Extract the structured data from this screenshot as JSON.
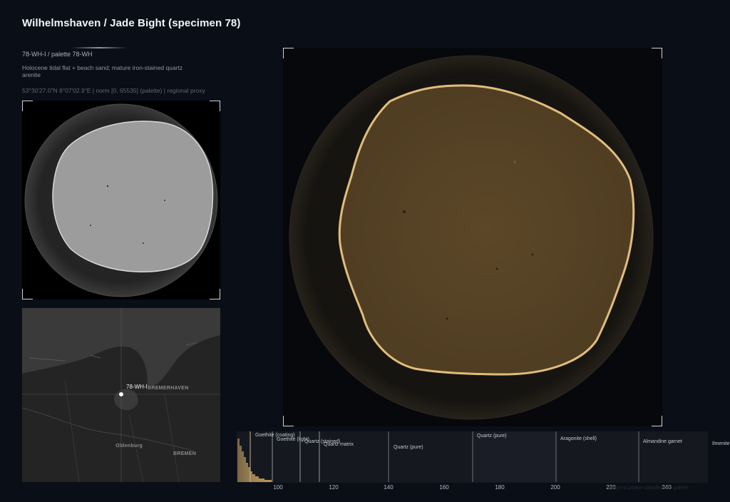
{
  "header": {
    "title": "Wilhelmshaven / Jade Bight (specimen 78)",
    "ident": "78-WH-I  /  palette 78-WH",
    "description": "Holocene tidal flat + beach sand; mature iron-stained quartz arenite",
    "coords": "53°30'27.0\"N 8°07'02.9\"E  |  norm [0, 65535] (palette)  |  regional proxy"
  },
  "map": {
    "pin_label": "78-WH-I",
    "cities": [
      "BREMERHAVEN",
      "Oldenburg",
      "BREMEN"
    ]
  },
  "histogram": {
    "phases": [
      {
        "label": "Goethite (coating)"
      },
      {
        "label": "Goethite (light)"
      },
      {
        "label": "Quartz (stained)"
      },
      {
        "label": "Quartz matrix"
      },
      {
        "label": "Quartz (pure)"
      },
      {
        "label": "Quartz (pure)"
      },
      {
        "label": "Aragonite (shell)"
      },
      {
        "label": "Almandine garnet"
      },
      {
        "label": "Ilmenite"
      }
    ],
    "ticks": [
      "100",
      "120",
      "140",
      "160",
      "180",
      "200",
      "220",
      "240"
    ],
    "watermark": "micro-ct phase-classification palette"
  },
  "colors": {
    "background": "#0a0e17",
    "grain_fill": "#5a4526",
    "grain_rim": "#d9b577",
    "thumb_fill": "#9a9a9a"
  }
}
